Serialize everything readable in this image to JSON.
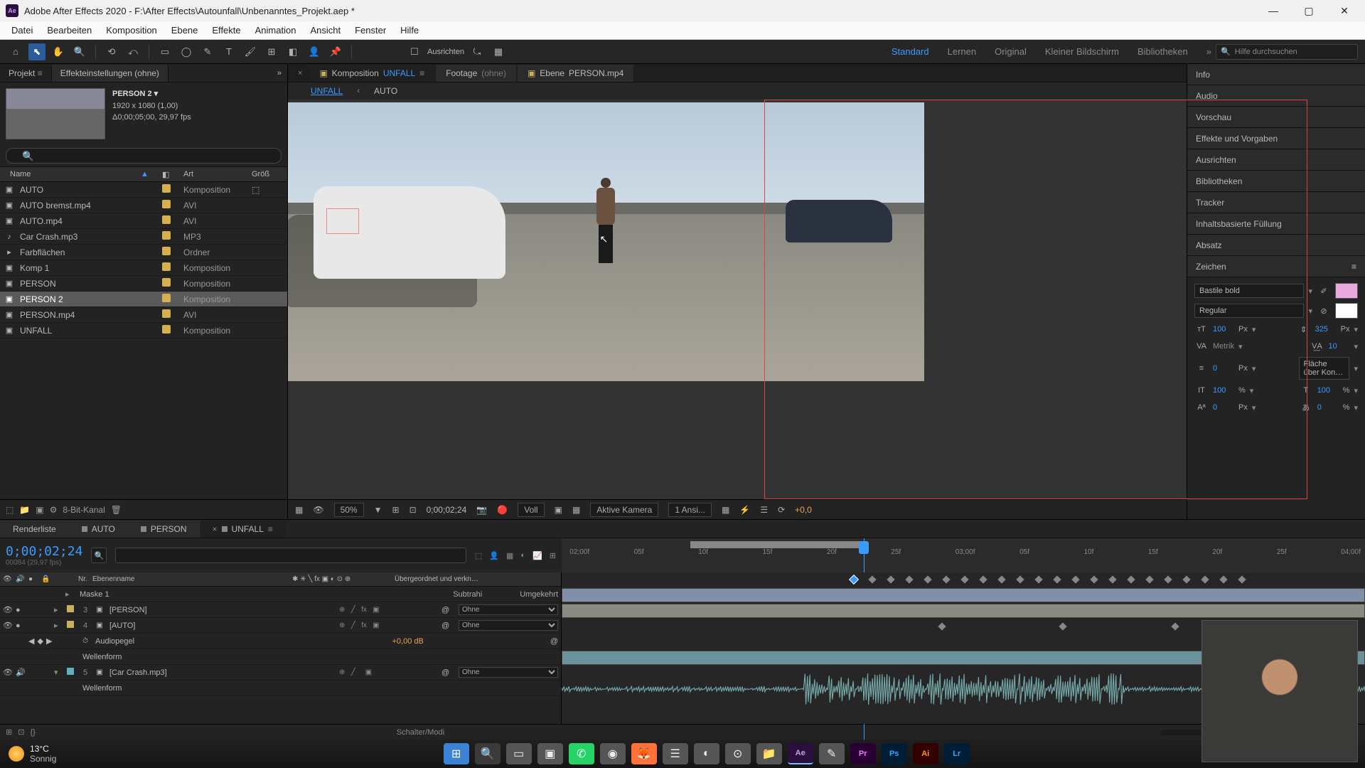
{
  "window": {
    "app_icon_label": "Ae",
    "title": "Adobe After Effects 2020 - F:\\After Effects\\Autounfall\\Unbenanntes_Projekt.aep *"
  },
  "menu": [
    "Datei",
    "Bearbeiten",
    "Komposition",
    "Ebene",
    "Effekte",
    "Animation",
    "Ansicht",
    "Fenster",
    "Hilfe"
  ],
  "toolbar": {
    "align_label": "Ausrichten",
    "workspaces": [
      "Standard",
      "Lernen",
      "Original",
      "Kleiner Bildschirm",
      "Bibliotheken"
    ],
    "workspace_active": "Standard",
    "search_placeholder": "Hilfe durchsuchen"
  },
  "project": {
    "tab_project": "Projekt",
    "tab_effects": "Effekteinstellungen  (ohne)",
    "selected": {
      "name": "PERSON 2 ▾",
      "dims": "1920 x 1080 (1,00)",
      "dur": "Δ0;00;05;00, 29,97 fps"
    },
    "headers": {
      "name": "Name",
      "tag": "",
      "art": "Art",
      "size": "Größ"
    },
    "items": [
      {
        "icon": "▣",
        "name": "AUTO",
        "color": "#d4b050",
        "art": "Komposition",
        "sub": "⬚"
      },
      {
        "icon": "▣",
        "name": "AUTO bremst.mp4",
        "color": "#d4b050",
        "art": "AVI"
      },
      {
        "icon": "▣",
        "name": "AUTO.mp4",
        "color": "#d4b050",
        "art": "AVI"
      },
      {
        "icon": "♪",
        "name": "Car Crash.mp3",
        "color": "#d4b050",
        "art": "MP3"
      },
      {
        "icon": "▸",
        "name": "Farbflächen",
        "color": "#d4b050",
        "art": "Ordner"
      },
      {
        "icon": "▣",
        "name": "Komp 1",
        "color": "#d4b050",
        "art": "Komposition"
      },
      {
        "icon": "▣",
        "name": "PERSON",
        "color": "#d4b050",
        "art": "Komposition"
      },
      {
        "icon": "▣",
        "name": "PERSON 2",
        "color": "#d4b050",
        "art": "Komposition",
        "selected": true
      },
      {
        "icon": "▣",
        "name": "PERSON.mp4",
        "color": "#d4b050",
        "art": "AVI"
      },
      {
        "icon": "▣",
        "name": "UNFALL",
        "color": "#d4b050",
        "art": "Komposition"
      }
    ],
    "footer_depth": "8-Bit-Kanal"
  },
  "viewer": {
    "tabs": [
      {
        "pre": "Komposition",
        "name": "UNFALL",
        "active": true
      },
      {
        "pre": "Footage",
        "name": "(ohne)"
      },
      {
        "pre": "Ebene",
        "name": "PERSON.mp4"
      }
    ],
    "subtabs": [
      "UNFALL",
      "AUTO"
    ],
    "subtab_sep": "‹",
    "bar": {
      "zoom": "50%",
      "time": "0;00;02;24",
      "res": "Voll",
      "camera": "Aktive Kamera",
      "views": "1 Ansi...",
      "offset": "+0,0"
    }
  },
  "right_panels": [
    "Info",
    "Audio",
    "Vorschau",
    "Effekte und Vorgaben",
    "Ausrichten",
    "Bibliotheken",
    "Tracker",
    "Inhaltsbasierte Füllung",
    "Absatz",
    "Zeichen"
  ],
  "zeichen": {
    "font": "Bastile bold",
    "style": "Regular",
    "size": "100",
    "size_u": "Px",
    "leading": "325",
    "leading_u": "Px",
    "kerning": "Metrik",
    "tracking": "10",
    "stroke": "0",
    "stroke_u": "Px",
    "stroke_mode": "Fläche über Kon…",
    "vscale": "100",
    "vscale_u": "%",
    "hscale": "100",
    "hscale_u": "%",
    "baseline": "0",
    "baseline_u": "Px",
    "tsume": "0",
    "tsume_u": "%"
  },
  "timeline": {
    "tabs": [
      "Renderliste",
      "AUTO",
      "PERSON",
      "UNFALL"
    ],
    "active_tab": 3,
    "timecode": "0;00;02;24",
    "timecode_sub": "00084 (29,97 fps)",
    "col_nr": "Nr.",
    "col_name": "Ebenenname",
    "col_parent": "Übergeordnet und verkn…",
    "ruler_ticks": [
      "02;00f",
      "05f",
      "10f",
      "15f",
      "20f",
      "25f",
      "03;00f",
      "05f",
      "10f",
      "15f",
      "20f",
      "25f",
      "04;00f"
    ],
    "layers": [
      {
        "num": "",
        "name": "Maske 1",
        "mode_a": "Subtrahi",
        "mode_b": "Umgekehrt",
        "kind": "mask"
      },
      {
        "num": "3",
        "name": "[PERSON]",
        "parent": "Ohne",
        "kind": "comp",
        "color": "#c8b060"
      },
      {
        "num": "4",
        "name": "[AUTO]",
        "parent": "Ohne",
        "kind": "comp",
        "color": "#c8b060"
      },
      {
        "num": "",
        "name": "Audiopegel",
        "value": "+0,00 dB",
        "kind": "prop"
      },
      {
        "num": "",
        "name": "Wellenform",
        "kind": "sub"
      },
      {
        "num": "5",
        "name": "[Car Crash.mp3]",
        "parent": "Ohne",
        "kind": "audio",
        "color": "#60b0c0"
      },
      {
        "num": "",
        "name": "Wellenform",
        "kind": "sub"
      }
    ],
    "footer_label": "Schalter/Modi"
  },
  "weather": {
    "temp": "13°C",
    "cond": "Sonnig"
  },
  "taskbar_apps": [
    {
      "cls": "win",
      "label": "⊞"
    },
    {
      "cls": "search",
      "label": "🔍"
    },
    {
      "cls": "generic",
      "label": "▭"
    },
    {
      "cls": "generic",
      "label": "▣"
    },
    {
      "cls": "wa",
      "label": "✆"
    },
    {
      "cls": "generic",
      "label": "◉"
    },
    {
      "cls": "ff",
      "label": "🦊"
    },
    {
      "cls": "generic",
      "label": "☰"
    },
    {
      "cls": "generic",
      "label": "◐"
    },
    {
      "cls": "generic",
      "label": "⊙"
    },
    {
      "cls": "generic",
      "label": "📁"
    },
    {
      "cls": "ae",
      "label": "Ae"
    },
    {
      "cls": "generic",
      "label": "✎"
    },
    {
      "cls": "pr",
      "label": "Pr"
    },
    {
      "cls": "ps",
      "label": "Ps"
    },
    {
      "cls": "ai",
      "label": "Ai"
    },
    {
      "cls": "lr",
      "label": "Lr"
    }
  ]
}
